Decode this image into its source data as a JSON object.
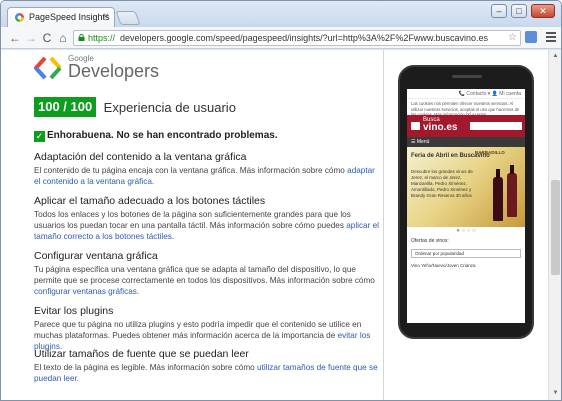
{
  "browser": {
    "tab_title": "PageSpeed Insights",
    "tab_close": "×",
    "url_scheme": "https://",
    "url_rest": "developers.google.com/speed/pagespeed/insights/?url=http%3A%2F%2Fwww.buscavino.es",
    "window_buttons": {
      "minimize": "–",
      "maximize": "□",
      "close": "✕"
    },
    "nav": {
      "back": "←",
      "forward": "→",
      "reload": "C",
      "home": "⌂"
    },
    "star": "☆"
  },
  "brand": {
    "google": "Google",
    "developers": "Developers",
    "colors": {
      "blue": "#4285f4",
      "red": "#ea4335",
      "yellow": "#fbbc05",
      "green": "#34a853"
    }
  },
  "score": {
    "badge": "100 / 100",
    "title": "Experiencia de usuario",
    "badge_color": "#0f9d20"
  },
  "congrats": "Enhorabuena. No se han encontrado problemas.",
  "rules": [
    {
      "title": "Adaptación del contenido a la ventana gráfica",
      "text": "El contenido de tu página encaja con la ventana gráfica. Más información sobre cómo ",
      "link": "adaptar el contenido a la ventana gráfica",
      "tail": "."
    },
    {
      "title": "Aplicar el tamaño adecuado a los botones táctiles",
      "text": "Todos los enlaces y los botones de la página son suficientemente grandes para que los usuarios los puedan tocar en una pantalla táctil. Más información sobre cómo puedes ",
      "link": "aplicar el tamaño correcto a los botones táctiles",
      "tail": "."
    },
    {
      "title": "Configurar ventana gráfica",
      "text": "Tu página especifica una ventana gráfica que se adapta al tamaño del dispositivo, lo que permite que se procese correctamente en todos los dispositivos. Más información sobre cómo ",
      "link": "configurar ventanas gráficas",
      "tail": "."
    },
    {
      "title": "Evitar los plugins",
      "text": "Parece que tu página no utiliza plugins y esto podría impedir que el contenido se utilice en muchas plataformas. Puedes obtener más información acerca de la importancia de ",
      "link": "evitar los plugins",
      "tail": "."
    },
    {
      "title": "Utilizar tamaños de fuente que se puedan leer",
      "text": "El texto de la página es legible. Más información sobre cómo ",
      "link": "utilizar tamaños de fuente que se puedan leer",
      "tail": "."
    }
  ],
  "phone_preview": {
    "status": "📞 Contacto ▾   👤 Mi cuenta",
    "cookie_text": "Las cookies nos permiten ofrecer nuestros servicios. Al utilizar nuestros servicios, aceptas el uso que hacemos de las cookies. Más información [X] Aceptar",
    "logo_top": "Busca",
    "logo_main": "vino.es",
    "nav": "☰ Menú",
    "banner_title": "Feria de Abril en Buscavino",
    "banner_text": "Descubre los grandes vinos de Jerez, el marco de Jerez, Manzanilla, Pedro Ximénez, Amontillado, Pedro Ximénez y Brandy Gran Reserva 30 años",
    "banner_brand": "BARBADILLO",
    "dots": "● ○ ○ ○",
    "offers_label": "Ofertas de vinos:",
    "select_value": "Ordenar por popularidad",
    "list_item": "Vino Yeño/Nuevo/Joven Crianza"
  },
  "scrollbar": {
    "up": "▲",
    "down": "▼"
  }
}
